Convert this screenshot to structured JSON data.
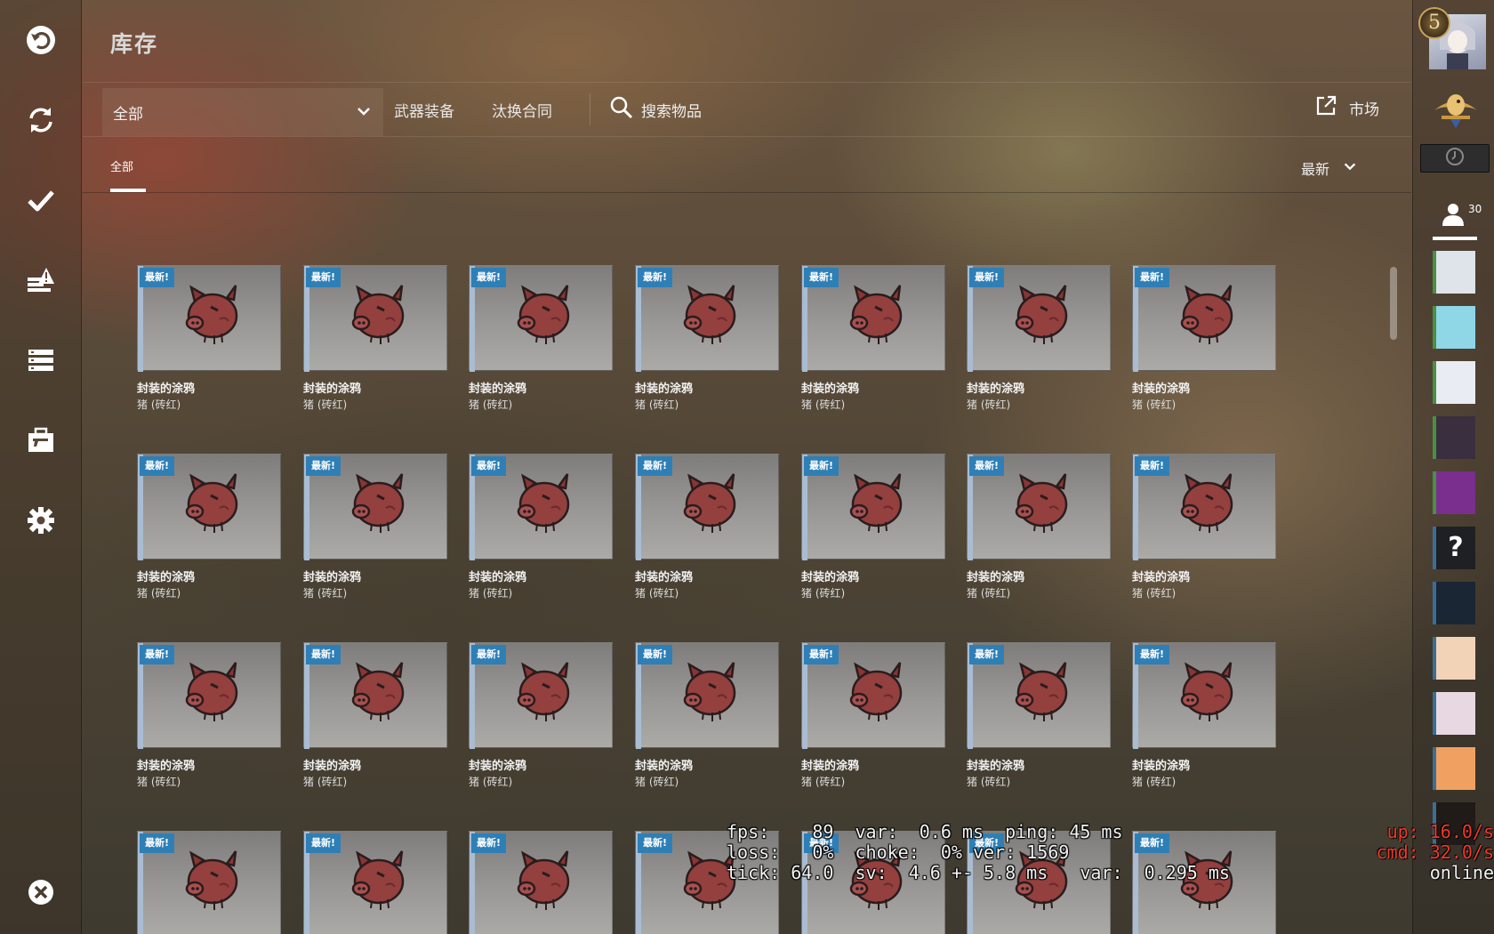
{
  "nav": {
    "items": [
      {
        "name": "back-icon",
        "id": "back"
      },
      {
        "name": "refresh-icon",
        "id": "refresh"
      },
      {
        "name": "checkmark-icon",
        "id": "check"
      },
      {
        "name": "alert-list-icon",
        "id": "alerts"
      },
      {
        "name": "list-icon",
        "id": "list"
      },
      {
        "name": "briefcase-icon",
        "id": "inventory"
      },
      {
        "name": "gear-icon",
        "id": "settings"
      },
      {
        "name": "close-icon",
        "id": "quit"
      }
    ]
  },
  "header": {
    "title": "库存"
  },
  "toolbar": {
    "filter_value": "全部",
    "weapons_label": "武器装备",
    "tradeup_label": "汰换合同",
    "search_label": "搜索物品",
    "market_label": "市场"
  },
  "subbar": {
    "tab_all": "全部",
    "sort_label": "最新"
  },
  "item": {
    "name": "封装的涂鸦",
    "sub": "猪 (砖红)",
    "badge": "最新!",
    "rarity_color": "#a9bcd2",
    "badge_color": "#2e7fb6"
  },
  "grid": {
    "columns": 7,
    "rows": 5
  },
  "rightpanel": {
    "level": "5",
    "friends_count": "30",
    "friends": [
      {
        "name": "penguin-avatar",
        "status": "online"
      },
      {
        "name": "pig-avatar",
        "status": "online"
      },
      {
        "name": "anime-girl-avatar",
        "status": "online"
      },
      {
        "name": "dark-girl-avatar",
        "status": "online"
      },
      {
        "name": "purple-girl-avatar",
        "status": "online"
      },
      {
        "name": "unknown-avatar",
        "status": "offline"
      },
      {
        "name": "space-avatar",
        "status": "offline"
      },
      {
        "name": "blonde-avatar",
        "status": "offline"
      },
      {
        "name": "pink-girl-avatar",
        "status": "offline"
      },
      {
        "name": "fox-girl-avatar",
        "status": "offline"
      },
      {
        "name": "fire-avatar",
        "status": "offline"
      }
    ]
  },
  "netgraph": {
    "line1": "fps:    89  var:  0.6 ms  ping: 45 ms",
    "line2": "loss:   0%  choke:  0% ver: 1569",
    "line3": "tick: 64.0  sv:  4.6 +- 5.8 ms   var:  0.295 ms",
    "up": "up: 16.0/s",
    "cmd": "cmd: 32.0/s",
    "status": "online"
  }
}
